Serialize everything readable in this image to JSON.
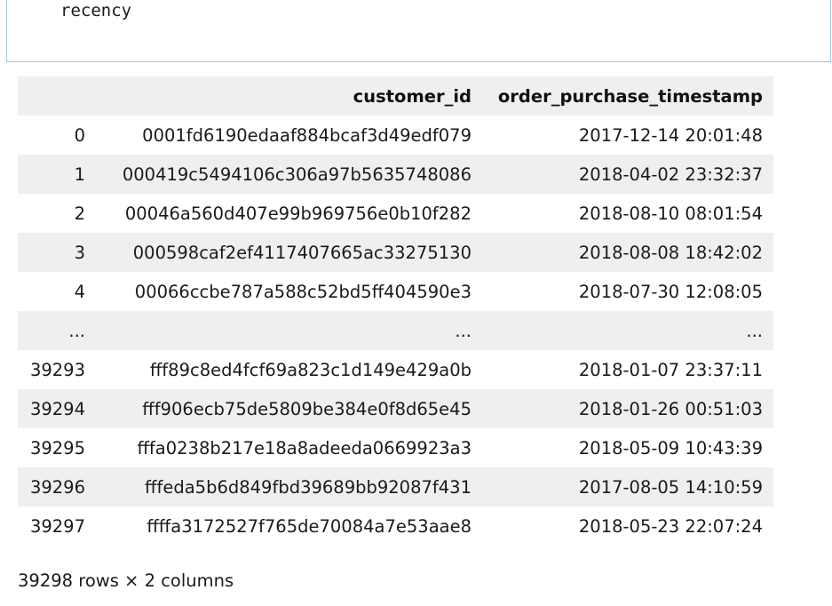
{
  "code_cell": {
    "code": "recency"
  },
  "dataframe": {
    "columns": [
      "",
      "customer_id",
      "order_purchase_timestamp"
    ],
    "rows": [
      {
        "index": "0",
        "customer_id": "0001fd6190edaaf884bcaf3d49edf079",
        "order_purchase_timestamp": "2017-12-14 20:01:48"
      },
      {
        "index": "1",
        "customer_id": "000419c5494106c306a97b5635748086",
        "order_purchase_timestamp": "2018-04-02 23:32:37"
      },
      {
        "index": "2",
        "customer_id": "00046a560d407e99b969756e0b10f282",
        "order_purchase_timestamp": "2018-08-10 08:01:54"
      },
      {
        "index": "3",
        "customer_id": "000598caf2ef4117407665ac33275130",
        "order_purchase_timestamp": "2018-08-08 18:42:02"
      },
      {
        "index": "4",
        "customer_id": "00066ccbe787a588c52bd5ff404590e3",
        "order_purchase_timestamp": "2018-07-30 12:08:05"
      },
      {
        "index": "...",
        "customer_id": "...",
        "order_purchase_timestamp": "..."
      },
      {
        "index": "39293",
        "customer_id": "fff89c8ed4fcf69a823c1d149e429a0b",
        "order_purchase_timestamp": "2018-01-07 23:37:11"
      },
      {
        "index": "39294",
        "customer_id": "fff906ecb75de5809be384e0f8d65e45",
        "order_purchase_timestamp": "2018-01-26 00:51:03"
      },
      {
        "index": "39295",
        "customer_id": "fffa0238b217e18a8adeeda0669923a3",
        "order_purchase_timestamp": "2018-05-09 10:43:39"
      },
      {
        "index": "39296",
        "customer_id": "fffeda5b6d849fbd39689bb92087f431",
        "order_purchase_timestamp": "2017-08-05 14:10:59"
      },
      {
        "index": "39297",
        "customer_id": "ffffa3172527f765de70084a7e53aae8",
        "order_purchase_timestamp": "2018-05-23 22:07:24"
      }
    ],
    "shape_text": "39298 rows × 2 columns"
  }
}
